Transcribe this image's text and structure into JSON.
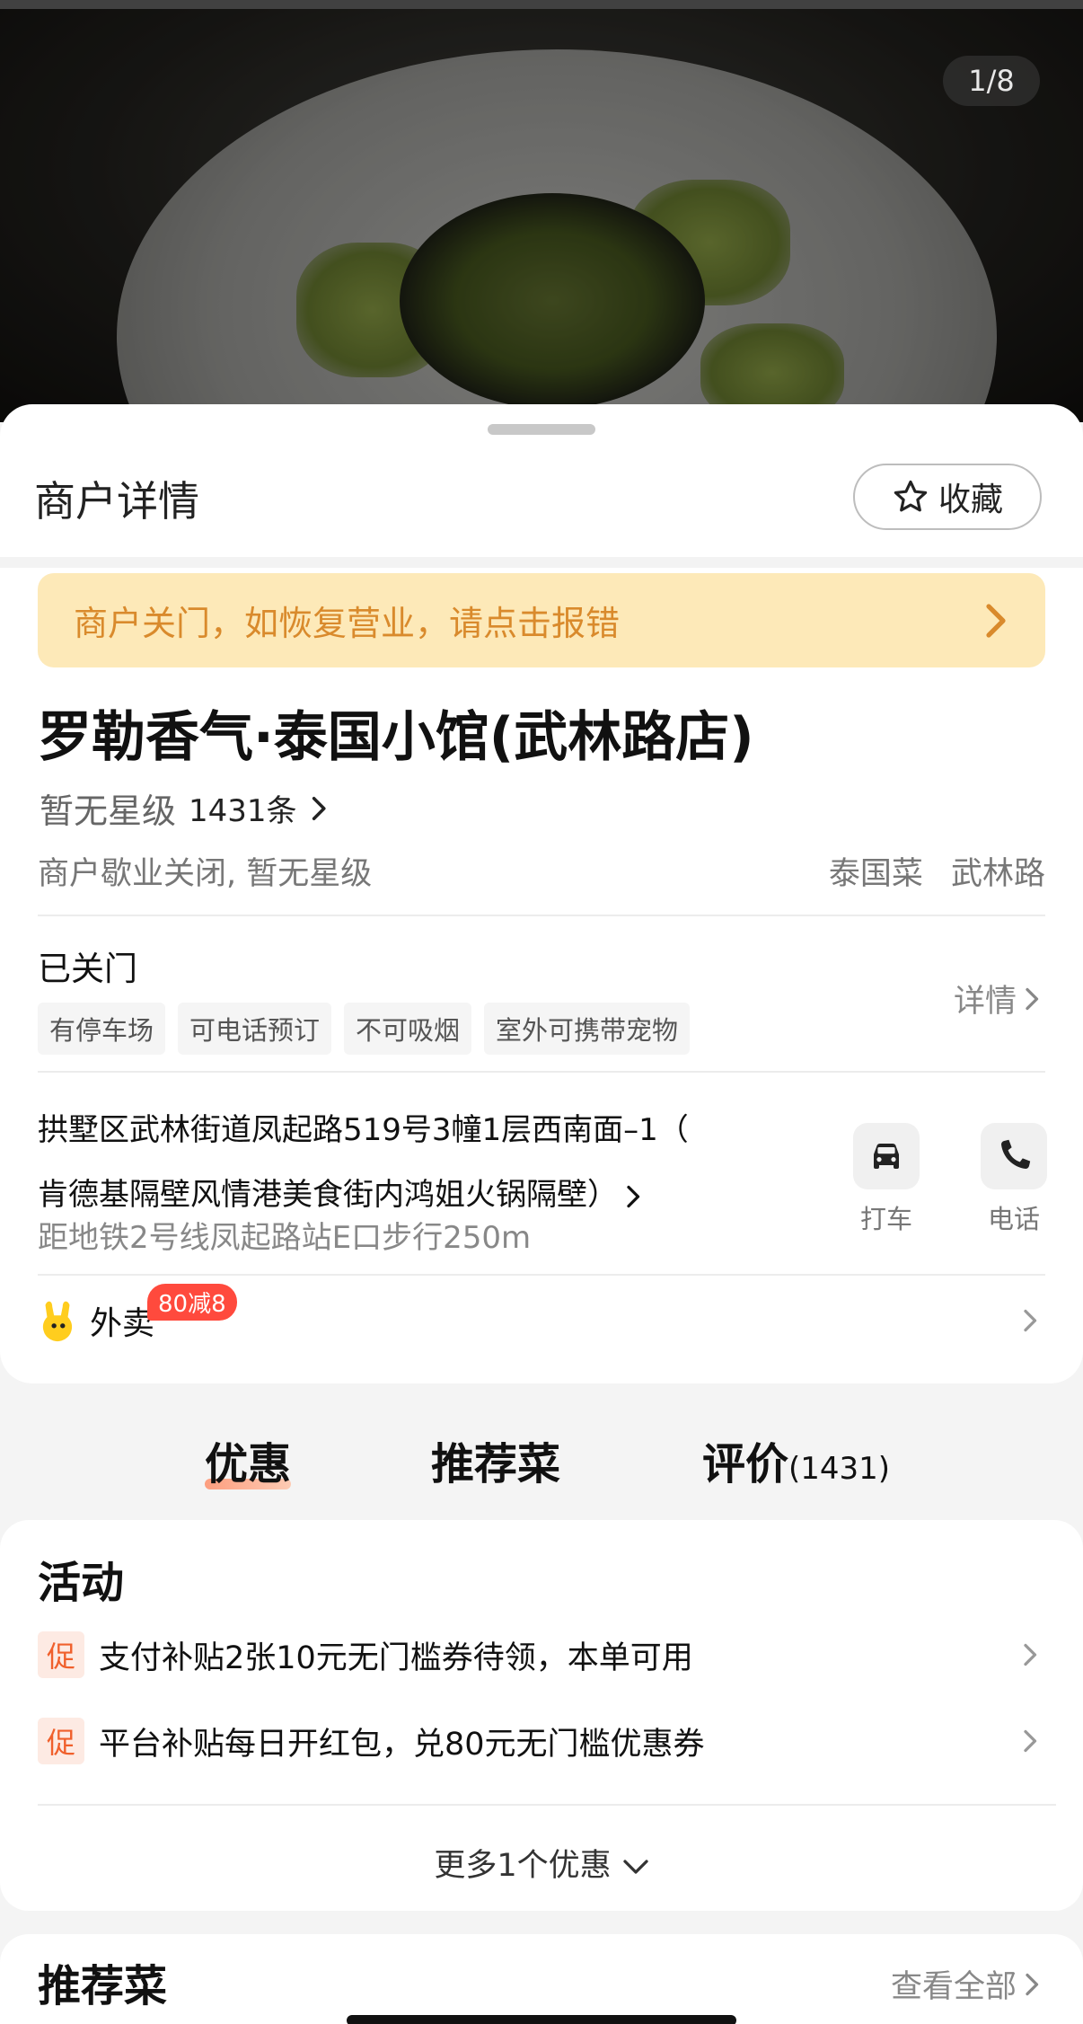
{
  "hero": {
    "counter": "1/8"
  },
  "sheet": {
    "title": "商户详情",
    "favorite_label": "收藏",
    "closed_banner": "商户关门，如恢复营业，请点击报错",
    "shop_name": "罗勒香气·泰国小馆(武林路店)",
    "rating_text": "暂无星级",
    "review_count": "1431条",
    "status_text": "商户歇业关闭, 暂无星级",
    "category_tags": [
      "泰国菜",
      "武林路"
    ],
    "open_status": "已关门",
    "facilities": [
      "有停车场",
      "可电话预订",
      "不可吸烟",
      "室外可携带宠物"
    ],
    "detail_label": "详情",
    "address_line1": "拱墅区武林街道凤起路519号3幢1层西南面–1（",
    "address_line2": "肯德基隔壁风情港美食街内鸿姐火锅隔壁）",
    "metro": "距地铁2号线凤起路站E口步行250m",
    "taxi_label": "打车",
    "phone_label": "电话",
    "takeout_label": "外卖",
    "takeout_badge": "80减8"
  },
  "tabs": [
    {
      "label": "优惠",
      "active": true
    },
    {
      "label": "推荐菜",
      "active": false
    },
    {
      "label": "评价",
      "count": "(1431)",
      "active": false
    }
  ],
  "activity": {
    "title": "活动",
    "promo_tag": "促",
    "promos": [
      "支付补贴2张10元无门槛券待领，本单可用",
      "平台补贴每日开红包，兑80元无门槛优惠券"
    ],
    "more": "更多1个优惠"
  },
  "recommend": {
    "title": "推荐菜",
    "see_all": "查看全部"
  },
  "colors": {
    "accent": "#f0602c",
    "banner_bg": "#fde9b8",
    "banner_text": "#d98a2c",
    "badge": "#ff4a3d"
  }
}
